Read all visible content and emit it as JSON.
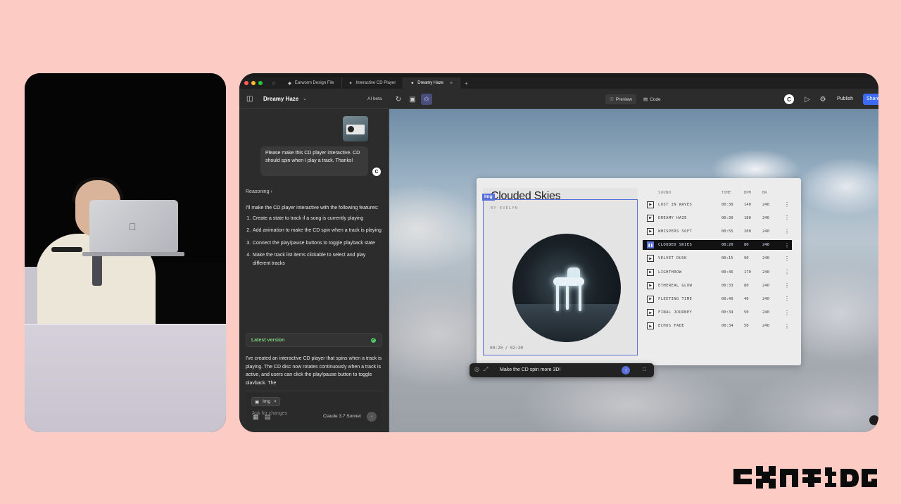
{
  "window": {
    "tabs": [
      {
        "label": "Earworm Design File",
        "icon": "figma-file-icon"
      },
      {
        "label": "Interactive CD Player",
        "icon": "make-file-icon"
      },
      {
        "label": "Dreamy Haze",
        "icon": "make-file-icon",
        "active": true
      }
    ],
    "traffic_colors": [
      "#ff5f57",
      "#febc2e",
      "#28c840"
    ]
  },
  "toolbar": {
    "project_title": "Dreamy Haze",
    "ai_badge": "AI beta",
    "preview_label": "Preview",
    "code_label": "Code",
    "publish_label": "Publish",
    "share_label": "Share",
    "accent": "#3d6cf2"
  },
  "chat": {
    "user_message": "Please make this CD player interactive. CD should spin when I play a track. Thanks!",
    "reasoning_label": "Reasoning",
    "reply_intro": "I'll make the CD player interactive with the following features:",
    "reply_steps": [
      "Create a state to track if a song is currently playing",
      "Add animation to make the CD spin when a track is playing",
      "Connect the play/pause buttons to toggle playback state",
      "Make the track list items clickable to select and play different tracks"
    ],
    "version_label": "Latest version",
    "reply_summary": "I've created an interactive CD player that spins when a track is playing. The CD disc now rotates continuously when a track is active, and users can click the play/pause button to toggle playback. The",
    "attachment_chip": "Img",
    "composer_placeholder": "Ask for changes",
    "model_label": "Claude 3.7 Sonnet"
  },
  "player": {
    "badge": "Img",
    "title": "Clouded Skies",
    "artist": "BY EVELYN",
    "time_readout": "00:20 / 02:30",
    "columns": {
      "sound": "SOUND",
      "time": "TIME",
      "bpm": "BPM",
      "br": "BR"
    },
    "tracks": [
      {
        "name": "LOST IN WAVES",
        "time": "00:30",
        "bpm": "140",
        "br": "240",
        "active": false
      },
      {
        "name": "DREAMY HAZE",
        "time": "00:30",
        "bpm": "180",
        "br": "240",
        "active": false
      },
      {
        "name": "WHISPERS SOFT",
        "time": "00:55",
        "bpm": "200",
        "br": "240",
        "active": false
      },
      {
        "name": "CLOUDED SKIES",
        "time": "00:20",
        "bpm": "80",
        "br": "240",
        "active": true
      },
      {
        "name": "VELVET DUSK",
        "time": "00:15",
        "bpm": "90",
        "br": "240",
        "active": false
      },
      {
        "name": "LIGHTHROW",
        "time": "00:46",
        "bpm": "170",
        "br": "240",
        "active": false
      },
      {
        "name": "ETHEREAL GLOW",
        "time": "00:33",
        "bpm": "80",
        "br": "240",
        "active": false
      },
      {
        "name": "FLEETING TIME",
        "time": "00:40",
        "bpm": "40",
        "br": "240",
        "active": false
      },
      {
        "name": "FINAL JOURNEY",
        "time": "00:34",
        "bpm": "50",
        "br": "240",
        "active": false
      },
      {
        "name": "ECHOS FADE",
        "time": "00:34",
        "bpm": "50",
        "br": "240",
        "active": false
      }
    ],
    "selection_color": "#5b6fd8"
  },
  "prompt_bar": {
    "text": "Make the CD spin more 3D!"
  },
  "brand": {
    "logo": "Config"
  }
}
